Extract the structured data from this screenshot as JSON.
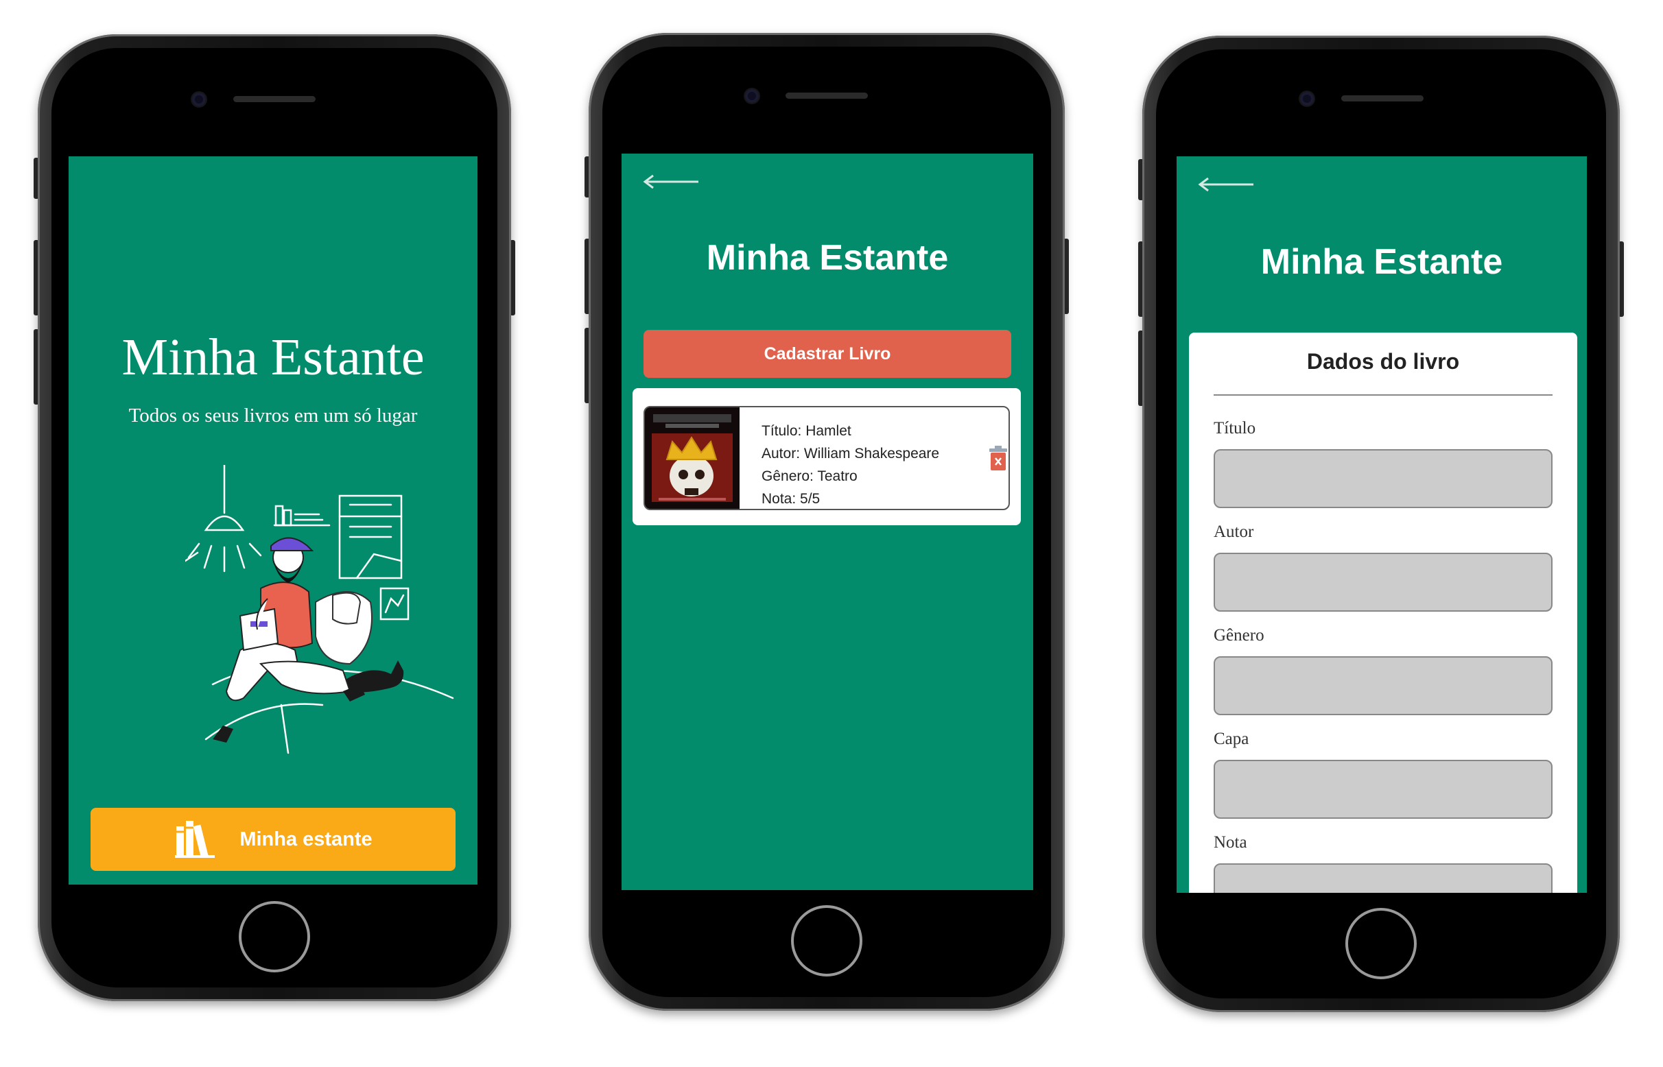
{
  "colors": {
    "screen_bg": "#038c6c",
    "accent_yellow": "#fbaa17",
    "accent_red": "#e0614c",
    "input_bg": "#cccccc"
  },
  "welcome": {
    "title": "Minha Estante",
    "subtitle": "Todos os seus livros em um só lugar",
    "illustration_icon": "person-reading-illustration",
    "button_icon": "books-icon",
    "button_label": "Minha estante"
  },
  "shelf": {
    "back_icon": "back-arrow-icon",
    "title": "Minha Estante",
    "add_button_label": "Cadastrar Livro",
    "books": [
      {
        "titulo": "Título: Hamlet",
        "autor": "Autor: William Shakespeare",
        "genero": "Gênero: Teatro",
        "nota": "Nota: 5/5",
        "cover_icon": "hamlet-cover-image",
        "delete_icon": "trash-icon"
      }
    ]
  },
  "form": {
    "back_icon": "back-arrow-icon",
    "title": "Minha Estante",
    "card_title": "Dados do livro",
    "fields": [
      {
        "label": "Título",
        "value": ""
      },
      {
        "label": "Autor",
        "value": ""
      },
      {
        "label": "Gênero",
        "value": ""
      },
      {
        "label": "Capa",
        "value": ""
      },
      {
        "label": "Nota",
        "value": ""
      }
    ]
  }
}
